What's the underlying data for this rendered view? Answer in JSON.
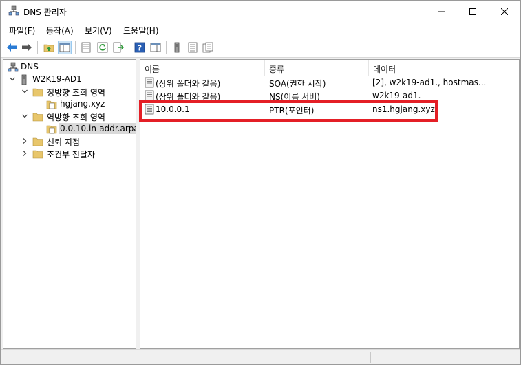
{
  "window": {
    "title": "DNS 관리자",
    "icon": "dns-manager-icon"
  },
  "menu": [
    {
      "label": "파일(F)"
    },
    {
      "label": "동작(A)"
    },
    {
      "label": "보기(V)"
    },
    {
      "label": "도움말(H)"
    }
  ],
  "toolbar": [
    "back-arrow-icon",
    "forward-arrow-icon",
    "up-folder-icon",
    "show-hide-tree-icon",
    "properties-icon",
    "refresh-icon",
    "export-list-icon",
    "help-icon",
    "show-pane-icon",
    "server-icon",
    "list-view-icon",
    "detail-view-icon"
  ],
  "tree": {
    "root": "DNS",
    "server": "W2K19-AD1",
    "forward_zone": "정방향 조회 영역",
    "forward_child": "hgjang.xyz",
    "reverse_zone": "역방향 조회 영역",
    "reverse_child": "0.0.10.in-addr.arpa",
    "trust_points": "신뢰 지점",
    "forwarders": "조건부 전달자"
  },
  "list": {
    "columns": [
      "이름",
      "종류",
      "데이터"
    ],
    "rows": [
      {
        "name": "(상위 폴더와 같음)",
        "type": "SOA(권한 시작)",
        "data": "[2], w2k19-ad1., hostmas..."
      },
      {
        "name": "(상위 폴더와 같음)",
        "type": "NS(이름 서버)",
        "data": "w2k19-ad1."
      },
      {
        "name": "10.0.0.1",
        "type": "PTR(포인터)",
        "data": "ns1.hgjang.xyz."
      }
    ]
  },
  "colors": {
    "highlight": "#e41f26",
    "selection": "#d9d9d9",
    "folder": "#e8c66b"
  }
}
